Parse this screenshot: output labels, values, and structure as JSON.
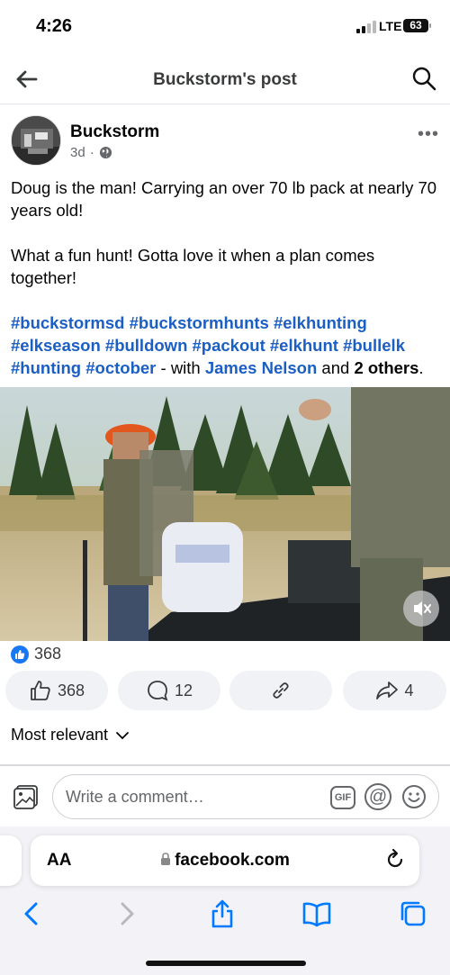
{
  "status_bar": {
    "time": "4:26",
    "network": "LTE",
    "battery": "63"
  },
  "header": {
    "title": "Buckstorm's post",
    "back_icon": "arrow-left-icon",
    "search_icon": "search-icon"
  },
  "post": {
    "author": "Buckstorm",
    "time": "3d",
    "separator": "·",
    "more_label": "•••",
    "paragraph1": "Doug is the man! Carrying an over 70 lb pack at nearly 70 years old!",
    "paragraph2": "What a fun hunt! Gotta love it when a plan comes together!",
    "hashtags": [
      "#buckstormsd",
      "#buckstormhunts",
      "#elkhunting",
      "#elkseason",
      "#bulldown",
      "#packout",
      "#elkhunt",
      "#bullelk",
      "#hunting",
      "#october"
    ],
    "with_text": " - with ",
    "with_person": "James Nelson",
    "and_text": " and ",
    "others": "2 others",
    "period": "."
  },
  "reactions": {
    "total": "368"
  },
  "actions": {
    "like_count": "368",
    "comment_count": "12",
    "share_count": "4"
  },
  "comments": {
    "sort_label": "Most relevant",
    "input_placeholder": "Write a comment…",
    "gif_label": "GIF",
    "mention_label": "@"
  },
  "browser": {
    "aa_label": "AA",
    "url": "facebook.com"
  },
  "colors": {
    "link": "#1b5fc4",
    "like_blue": "#1877f2",
    "ios_blue": "#007aff"
  }
}
